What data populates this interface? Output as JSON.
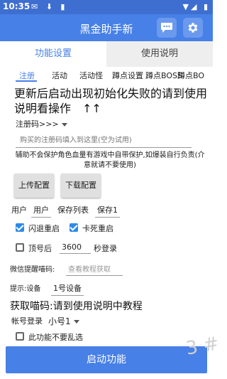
{
  "status": {
    "time": "10:35"
  },
  "appbar": {
    "title": "黑金助手新"
  },
  "main_tabs": {
    "active": "功能设置",
    "inactive": "使用说明"
  },
  "sub_tabs": [
    "注册",
    "活动",
    "活动怪",
    "蹲点设置",
    "蹲点BOSS",
    "蹲点BO"
  ],
  "notice": "更新后启动出现初始化失败的请到使用说明看操作　↑↑",
  "register": {
    "select_label": "注册码>>>",
    "input_placeholder": "购买的注册码填入到这里(空为试用)"
  },
  "warning": "辅助不会保护角色血量有游戏中自带保护,如爆装自行负责(介意就请不要使用)",
  "buttons": {
    "upload": "上传配置",
    "download": "下载配置",
    "start": "启动功能"
  },
  "user_row": {
    "label": "用户",
    "field": "用户",
    "save_list": "保存列表",
    "save_value": "保存1"
  },
  "checks": {
    "crash_restart": "闪退重启",
    "freeze_restart": "卡死重启"
  },
  "relogin": {
    "label_before": "顶号后",
    "seconds": "3600",
    "label_after": "秒登录"
  },
  "wechat": {
    "label": "微信提醒喵码:",
    "placeholder": "查看教程获取"
  },
  "device": {
    "label": "提示:设备",
    "value": "1号设备"
  },
  "section_title": "获取喵码:请到使用说明中教程",
  "account": {
    "label": "帐号登录",
    "value": "小号1"
  },
  "no_mess": "此功能不要乱选",
  "watermark": "3 #"
}
